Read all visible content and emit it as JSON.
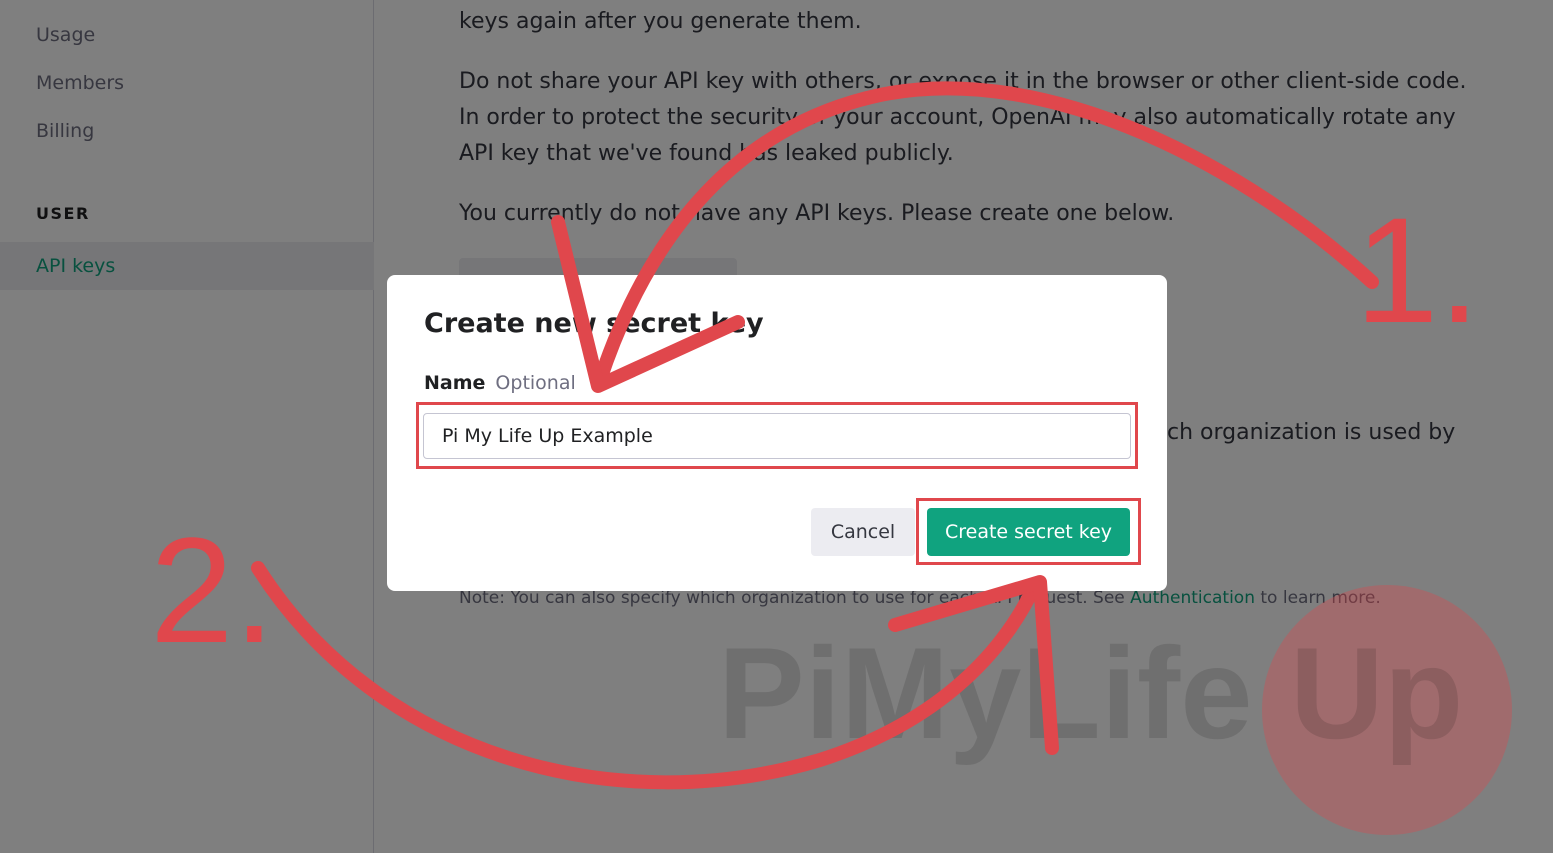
{
  "sidebar": {
    "items": [
      {
        "label": "Usage"
      },
      {
        "label": "Members"
      },
      {
        "label": "Billing"
      }
    ],
    "section_heading": "USER",
    "active_item": "API keys"
  },
  "content": {
    "para1": "keys again after you generate them.",
    "para2": "Do not share your API key with others, or expose it in the browser or other client-side code. In order to protect the security of your account, OpenAI may also automatically rotate any API key that we've found has leaked publicly.",
    "para3": "You currently do not have any API keys. Please create one below.",
    "para4_partial": "ch organization is used by",
    "note_prefix": "Note: You can also specify which organization to use for each API request. See",
    "note_link": "Authentication",
    "note_suffix": "to learn more."
  },
  "modal": {
    "title": "Create new secret key",
    "name_label": "Name",
    "optional_label": "Optional",
    "name_value": "Pi My Life Up Example",
    "cancel_label": "Cancel",
    "create_label": "Create secret key"
  },
  "annotations": {
    "step1": "1.",
    "step2": "2.",
    "color": "#e0474c"
  },
  "watermark": {
    "text": "PiMyLife",
    "badge": "Up"
  },
  "colors": {
    "accent": "#10a37f",
    "annotation": "#e0474c"
  }
}
